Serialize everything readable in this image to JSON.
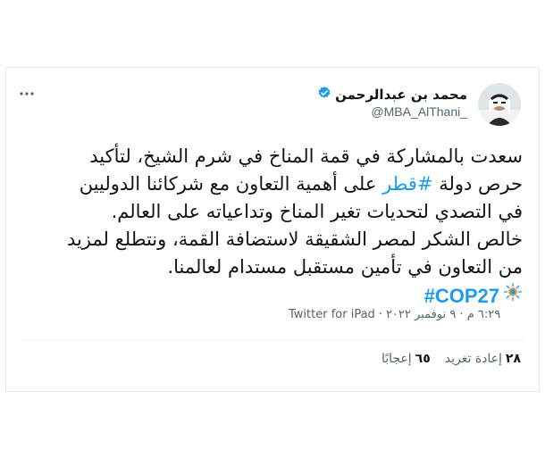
{
  "user": {
    "name": "محمد بن عبدالرحمن",
    "handle": "@MBA_AlThani_"
  },
  "tweet": {
    "line1": "سعدت بالمشاركة في قمة المناخ في شرم الشيخ، لتأكيد",
    "line2_pre": "حرص دولة ",
    "line2_link": "#قطر",
    "line2_post": " على أهمية التعاون مع شركائنا الدوليين",
    "line3": "في التصدي لتحديات تغير المناخ وتداعياته على العالم.",
    "line4": "خالص الشكر لمصر الشقيقة لاستضافة القمة، ونتطلع لمزيد",
    "line5": "من التعاون في تأمين مستقبل مستدام لعالمنا.",
    "hashtag": "#COP27"
  },
  "meta": {
    "source": "Twitter for iPad",
    "separator": "·",
    "datetime": "٦:٢٩ م · ٩ نوفمبر ٢٠٢٢"
  },
  "stats": {
    "retweets_count": "٢٨",
    "retweets_label": "إعادة تغريد",
    "likes_count": "٦٥",
    "likes_label": "إعجابًا"
  },
  "colors": {
    "link": "#1d9bf0",
    "verified": "#1d9bf0",
    "text": "#0f1419",
    "muted": "#536471"
  },
  "icons": {
    "verified": "verified-badge-icon",
    "more": "more-options-icon",
    "cop_logo": "cop27-logo-icon"
  }
}
